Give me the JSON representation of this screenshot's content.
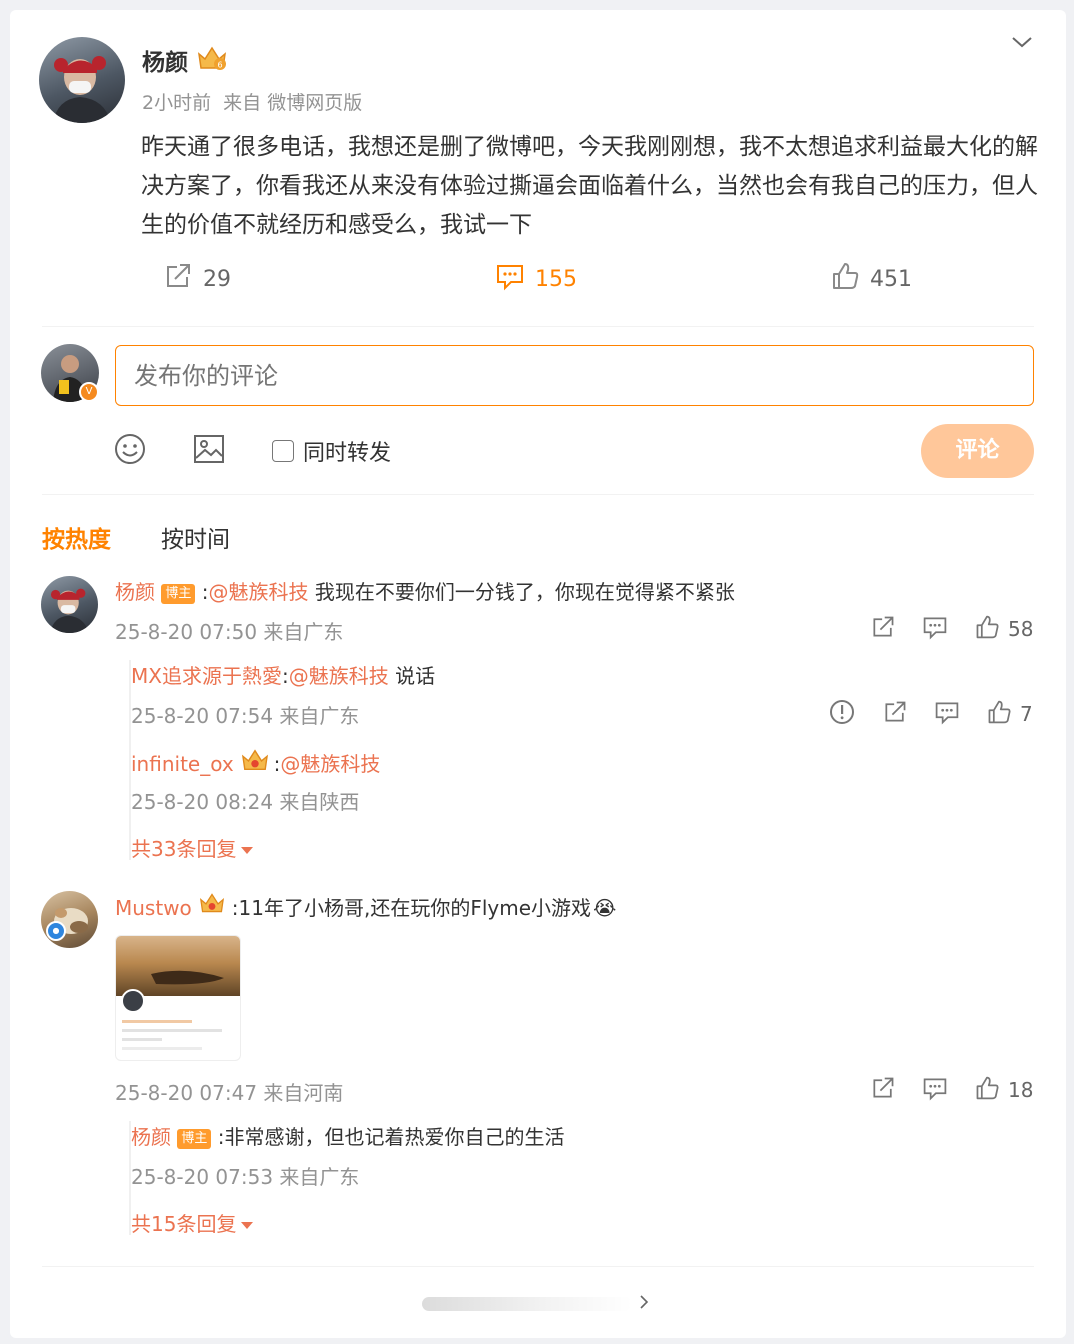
{
  "post": {
    "author": "杨颜",
    "meta": "2小时前  来自 微博网页版",
    "content": "昨天通了很多电话，我想还是删了微博吧，今天我刚刚想，我不太想追求利益最大化的解决方案了，你看我还从来没有体验过撕逼会面临着什么，当然也会有我自己的压力，但人生的价值不就经历和感受么，我试一下",
    "reposts": "29",
    "comments": "155",
    "likes": "451",
    "more_icon": "chevron-down-icon"
  },
  "composer": {
    "placeholder": "发布你的评论",
    "sync_repost_label": "同时转发",
    "submit_label": "评论"
  },
  "sort_tabs": {
    "hot": "按热度",
    "time": "按时间"
  },
  "comments": [
    {
      "author": "杨颜",
      "badge": "博主",
      "mention": "@魅族科技",
      "text": "我现在不要你们一分钱了，你现在觉得紧不紧张",
      "meta": "25-8-20 07:50 来自广东",
      "likes": "58",
      "replies": [
        {
          "author": "MX追求源于熱愛",
          "mention": "@魅族科技",
          "text": "说话",
          "meta": "25-8-20 07:54 来自广东",
          "likes": "7"
        },
        {
          "author": "infinite_ox",
          "mention": "@魅族科技",
          "text": "",
          "meta": "25-8-20 08:24 来自陕西"
        }
      ],
      "more_replies": "共33条回复"
    },
    {
      "author": "Mustwo",
      "text": ":11年了小杨哥,还在玩你的Flyme小游戏",
      "emoji": "😭",
      "meta": "25-8-20 07:47 来自河南",
      "likes": "18",
      "replies": [
        {
          "author": "杨颜",
          "badge": "博主",
          "text": ":非常感谢，但也记着热爱你自己的生活",
          "meta": "25-8-20 07:53 来自广东"
        }
      ],
      "more_replies": "共15条回复"
    }
  ],
  "colors": {
    "accent": "#ff8200",
    "link": "#eb7350",
    "badge": "#ff9b2d",
    "submit_disabled": "#ffc79a"
  }
}
